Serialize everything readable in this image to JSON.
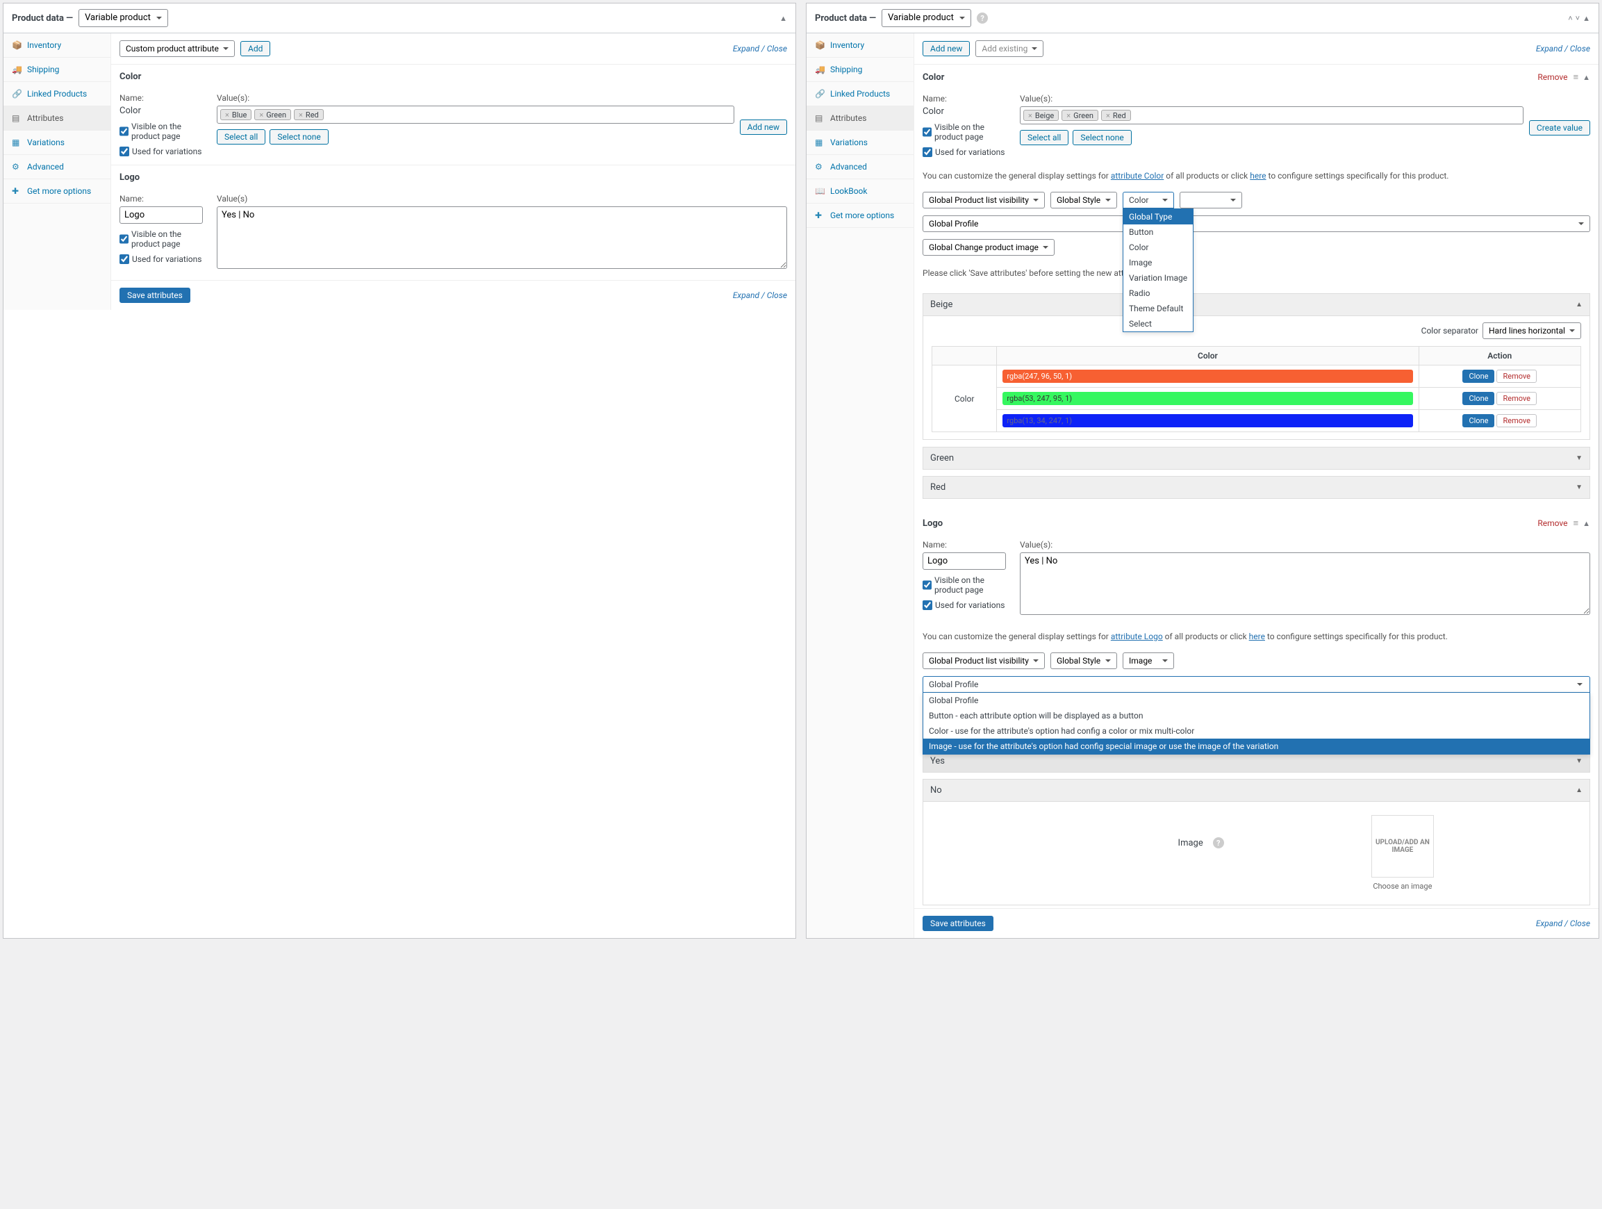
{
  "left": {
    "header_label": "Product data",
    "header_dash": "—",
    "product_type": "Variable product",
    "tabs": [
      "Inventory",
      "Shipping",
      "Linked Products",
      "Attributes",
      "Variations",
      "Advanced",
      "Get more options"
    ],
    "attr_select": "Custom product attribute",
    "add_btn": "Add",
    "expand_close": "Expand / Close",
    "attr1": {
      "title": "Color",
      "name_label": "Name:",
      "name_value": "Color",
      "values_label": "Value(s):",
      "tags": [
        "Blue",
        "Green",
        "Red"
      ],
      "visible": "Visible on the product page",
      "used": "Used for variations",
      "select_all": "Select all",
      "select_none": "Select none",
      "add_new": "Add new"
    },
    "attr2": {
      "title": "Logo",
      "name_label": "Name:",
      "name_value": "Logo",
      "values_label": "Value(s)",
      "values_text": "Yes | No",
      "visible": "Visible on the product page",
      "used": "Used for variations"
    },
    "save_btn": "Save attributes"
  },
  "right": {
    "header_label": "Product data",
    "header_dash": "—",
    "product_type": "Variable product",
    "tabs": [
      "Inventory",
      "Shipping",
      "Linked Products",
      "Attributes",
      "Variations",
      "Advanced",
      "LookBook",
      "Get more options"
    ],
    "add_new": "Add new",
    "add_existing": "Add existing",
    "expand_close": "Expand / Close",
    "color": {
      "title": "Color",
      "remove": "Remove",
      "name_label": "Name:",
      "name_value": "Color",
      "values_label": "Value(s):",
      "tags": [
        "Beige",
        "Green",
        "Red"
      ],
      "visible": "Visible on the product page",
      "used": "Used for variations",
      "select_all": "Select all",
      "select_none": "Select none",
      "create_value": "Create value",
      "desc_pre": "You can customize the general display settings for ",
      "desc_link": "attribute Color",
      "desc_mid": " of all products or click ",
      "desc_here": "here",
      "desc_post": " to configure settings specifically for this product.",
      "sel_visibility": "Global Product list visibility",
      "sel_style": "Global Style",
      "color_dropdown_display": "Color",
      "color_dropdown_options": [
        "Global Type",
        "Button",
        "Color",
        "Image",
        "Variation Image",
        "Radio",
        "Theme Default",
        "Select"
      ],
      "sel_profile": "Global Profile",
      "sel_change_img": "Global Change product image",
      "save_note": "Please click 'Save attributes' before setting the new attribute's settings.",
      "acc_beige": "Beige",
      "color_sep_label": "Color separator",
      "color_sep_value": "Hard lines horizontal",
      "table_col_color": "Color",
      "table_col_action": "Action",
      "row_label": "Color",
      "colors": [
        {
          "text": "rgba(247, 96, 50, 1)",
          "bg": "#f76032",
          "fg": "#fff"
        },
        {
          "text": "rgba(53, 247, 95, 1)",
          "bg": "#35f75f",
          "fg": "#333"
        },
        {
          "text": "rgba(13, 34, 247, 1)",
          "bg": "#0d22f7",
          "fg": "#668"
        }
      ],
      "clone": "Clone",
      "remove_btn": "Remove",
      "acc_green": "Green",
      "acc_red": "Red"
    },
    "logo": {
      "title": "Logo",
      "remove": "Remove",
      "name_label": "Name:",
      "name_value": "Logo",
      "values_label": "Value(s):",
      "values_text": "Yes | No",
      "visible": "Visible on the product page",
      "used": "Used for variations",
      "desc_pre": "You can customize the general display settings for ",
      "desc_link": "attribute Logo",
      "desc_mid": " of all products or click ",
      "desc_here": "here",
      "desc_post": " to configure settings specifically for this product.",
      "sel_visibility": "Global Product list visibility",
      "sel_style": "Global Style",
      "sel_type": "Image",
      "profile_display": "Global Profile",
      "profile_options": [
        "Global Profile",
        "Button - each attribute option will be displayed as a button",
        "Color - use for the attribute's option had config a color or mix multi-color",
        "Image - use for the attribute's option had config special image or use the image of the variation"
      ],
      "acc_yes": "Yes",
      "acc_no": "No",
      "image_label": "Image",
      "upload_text": "UPLOAD/ADD AN IMAGE",
      "choose_text": "Choose an image"
    },
    "save_btn": "Save attributes"
  }
}
